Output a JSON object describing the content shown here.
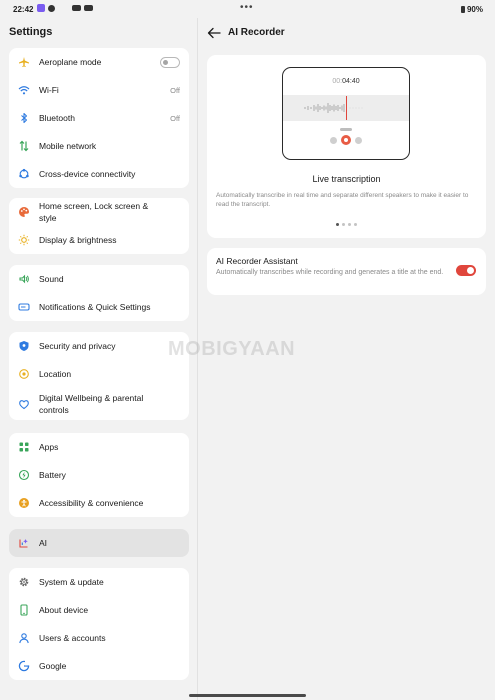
{
  "status_bar": {
    "time": "22:42",
    "more": "•••",
    "battery": "90%"
  },
  "settings": {
    "title": "Settings",
    "groups": [
      [
        {
          "label": "Aeroplane mode",
          "icon": "airplane-icon",
          "toggle": "off"
        },
        {
          "label": "Wi-Fi",
          "value": "Off",
          "icon": "wifi-icon"
        },
        {
          "label": "Bluetooth",
          "value": "Off",
          "icon": "bluetooth-icon"
        },
        {
          "label": "Mobile network",
          "icon": "mobile-network-icon"
        },
        {
          "label": "Cross-device connectivity",
          "icon": "cross-device-icon"
        }
      ],
      [
        {
          "label": "Home screen, Lock screen & style",
          "icon": "palette-icon"
        },
        {
          "label": "Display & brightness",
          "icon": "sun-icon"
        }
      ],
      [
        {
          "label": "Sound",
          "icon": "sound-icon"
        },
        {
          "label": "Notifications & Quick Settings",
          "icon": "notifications-icon"
        }
      ],
      [
        {
          "label": "Security and privacy",
          "icon": "shield-icon"
        },
        {
          "label": "Location",
          "icon": "location-icon"
        },
        {
          "label": "Digital Wellbeing & parental controls",
          "icon": "wellbeing-icon"
        }
      ],
      [
        {
          "label": "Apps",
          "icon": "apps-icon"
        },
        {
          "label": "Battery",
          "icon": "battery-icon"
        },
        {
          "label": "Accessibility & convenience",
          "icon": "accessibility-icon"
        }
      ],
      [
        {
          "label": "AI",
          "icon": "ai-icon",
          "selected": true
        }
      ],
      [
        {
          "label": "System & update",
          "icon": "gear-icon"
        },
        {
          "label": "About device",
          "icon": "phone-icon"
        },
        {
          "label": "Users & accounts",
          "icon": "user-icon"
        },
        {
          "label": "Google",
          "icon": "google-icon"
        }
      ]
    ]
  },
  "detail": {
    "title": "AI Recorder",
    "demo": {
      "timer_prefix": "00:",
      "timer_value": "04:40",
      "title": "Live transcription",
      "description": "Automatically transcribe in real time and separate different speakers to make it easier to read the transcript.",
      "pages": 4,
      "active_page": 1
    },
    "assistant": {
      "title": "AI Recorder Assistant",
      "description": "Automatically transcribes while recording and generates a title at the end.",
      "enabled": true
    }
  },
  "watermark": "MOBIGYAAN",
  "colors": {
    "accent": "#e0463c",
    "toggle_on": "#e0463c"
  }
}
